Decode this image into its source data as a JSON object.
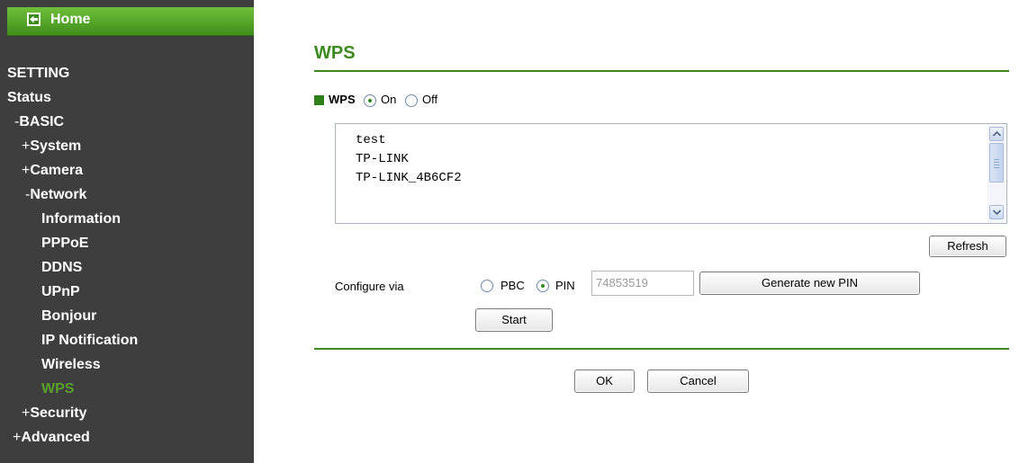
{
  "sidebar": {
    "home_label": "Home",
    "items": [
      {
        "prefix": "",
        "label": "SETTING"
      },
      {
        "prefix": "",
        "label": "Status"
      },
      {
        "prefix": "-",
        "label": "BASIC"
      },
      {
        "prefix": "+",
        "label": "System"
      },
      {
        "prefix": "+",
        "label": "Camera"
      },
      {
        "prefix": "-",
        "label": "Network"
      },
      {
        "prefix": "",
        "label": "Information"
      },
      {
        "prefix": "",
        "label": "PPPoE"
      },
      {
        "prefix": "",
        "label": "DDNS"
      },
      {
        "prefix": "",
        "label": "UPnP"
      },
      {
        "prefix": "",
        "label": "Bonjour"
      },
      {
        "prefix": "",
        "label": "IP Notification"
      },
      {
        "prefix": "",
        "label": "Wireless"
      },
      {
        "prefix": "",
        "label": "WPS"
      },
      {
        "prefix": "+",
        "label": "Security"
      },
      {
        "prefix": "+",
        "label": "Advanced"
      }
    ],
    "active_item": "WPS"
  },
  "main": {
    "title": "WPS",
    "wps_toggle": {
      "label": "WPS",
      "on_label": "On",
      "off_label": "Off",
      "selected": "On"
    },
    "ssid_list": [
      "test",
      "TP-LINK",
      "TP-LINK_4B6CF2"
    ],
    "refresh_label": "Refresh",
    "configure": {
      "label": "Configure via",
      "pbc_label": "PBC",
      "pin_label": "PIN",
      "selected": "PIN",
      "pin_value": "74853519",
      "generate_label": "Generate new PIN",
      "start_label": "Start"
    },
    "ok_label": "OK",
    "cancel_label": "Cancel"
  },
  "colors": {
    "accent": "#3a8a1e",
    "sidebar_bg": "#3e3e3e",
    "active_nav": "#5aa02c"
  }
}
